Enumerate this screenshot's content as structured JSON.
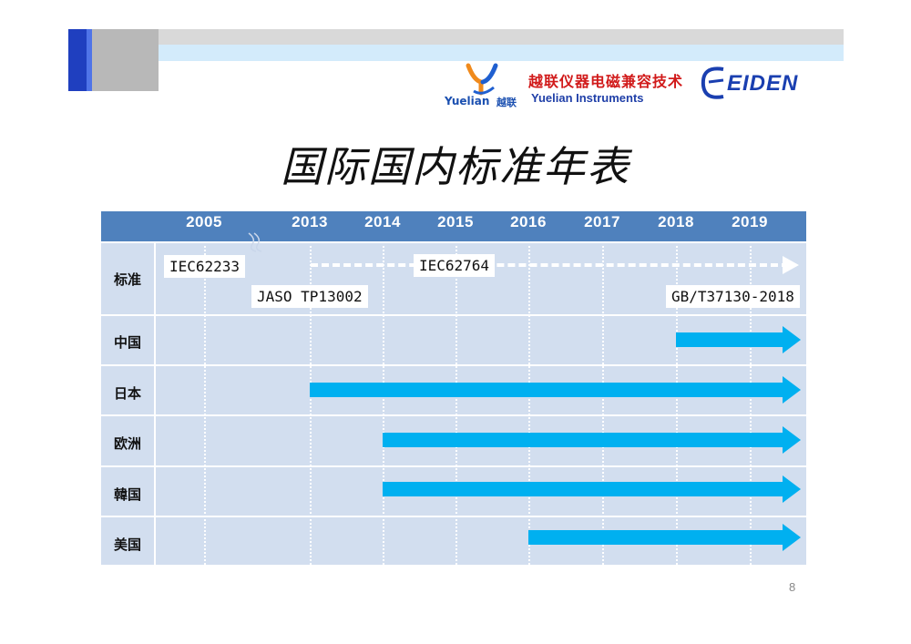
{
  "header": {
    "company_cn": "越联仪器电磁兼容技术",
    "company_en": "Yuelian Instruments",
    "logo_text_en": "Yuelian",
    "logo_text_cn": "越联",
    "brand_logo": "EIDEN"
  },
  "title": "国际国内标准年表",
  "years": [
    "2005",
    "2013",
    "2014",
    "2015",
    "2016",
    "2017",
    "2018",
    "2019"
  ],
  "rows": [
    {
      "label": "标准"
    },
    {
      "label": "中国",
      "start": "2018"
    },
    {
      "label": "日本",
      "start": "2013"
    },
    {
      "label": "欧洲",
      "start": "2014"
    },
    {
      "label": "韓国",
      "start": "2014"
    },
    {
      "label": "美国",
      "start": "2016"
    }
  ],
  "standards": [
    "IEC62233",
    "JASO TP13002",
    "IEC62764",
    "GB/T37130-2018"
  ],
  "page_number": "8",
  "colors": {
    "header_blue": "#4f81bd",
    "row_fill": "#d2deef",
    "arrow": "#00b0f0",
    "company_red": "#d11a1a"
  },
  "icons": [
    "yuelian-logo-icon",
    "eiden-logo-icon",
    "axis-break-icon"
  ]
}
